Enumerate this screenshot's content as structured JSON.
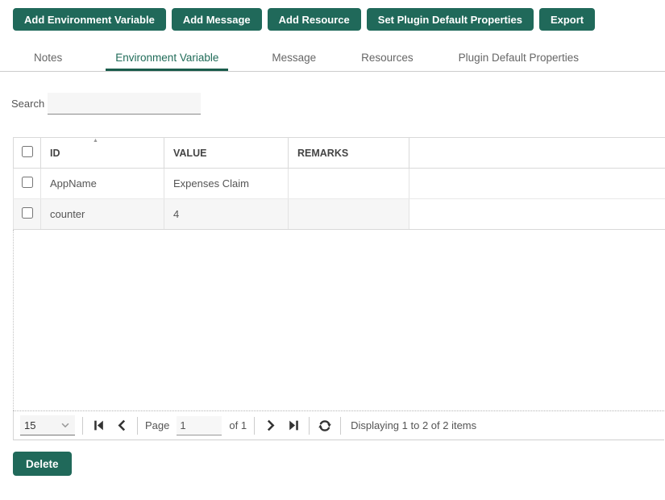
{
  "colors": {
    "primary": "#20695a",
    "tab_active": "#1f6b58",
    "tab_underline": "#1a5c4b"
  },
  "toolbar": {
    "buttons": [
      {
        "label": "Add Environment Variable"
      },
      {
        "label": "Add Message"
      },
      {
        "label": "Add Resource"
      },
      {
        "label": "Set Plugin Default Properties"
      },
      {
        "label": "Export"
      }
    ]
  },
  "tabs": {
    "active_index": 1,
    "items": [
      {
        "label": "Notes"
      },
      {
        "label": "Environment Variable"
      },
      {
        "label": "Message"
      },
      {
        "label": "Resources"
      },
      {
        "label": "Plugin Default Properties"
      }
    ]
  },
  "search": {
    "label": "Search",
    "value": ""
  },
  "table": {
    "sort_indicator": "▲",
    "columns": [
      {
        "label": "ID"
      },
      {
        "label": "VALUE"
      },
      {
        "label": "REMARKS"
      }
    ],
    "rows": [
      {
        "id": "AppName",
        "value": "Expenses Claim",
        "remarks": ""
      },
      {
        "id": "counter",
        "value": "4",
        "remarks": ""
      }
    ]
  },
  "pager": {
    "page_size": "15",
    "page_label": "Page",
    "page_value": "1",
    "of_text": "of 1",
    "status": "Displaying 1 to 2 of 2 items"
  },
  "footer": {
    "delete_label": "Delete"
  }
}
